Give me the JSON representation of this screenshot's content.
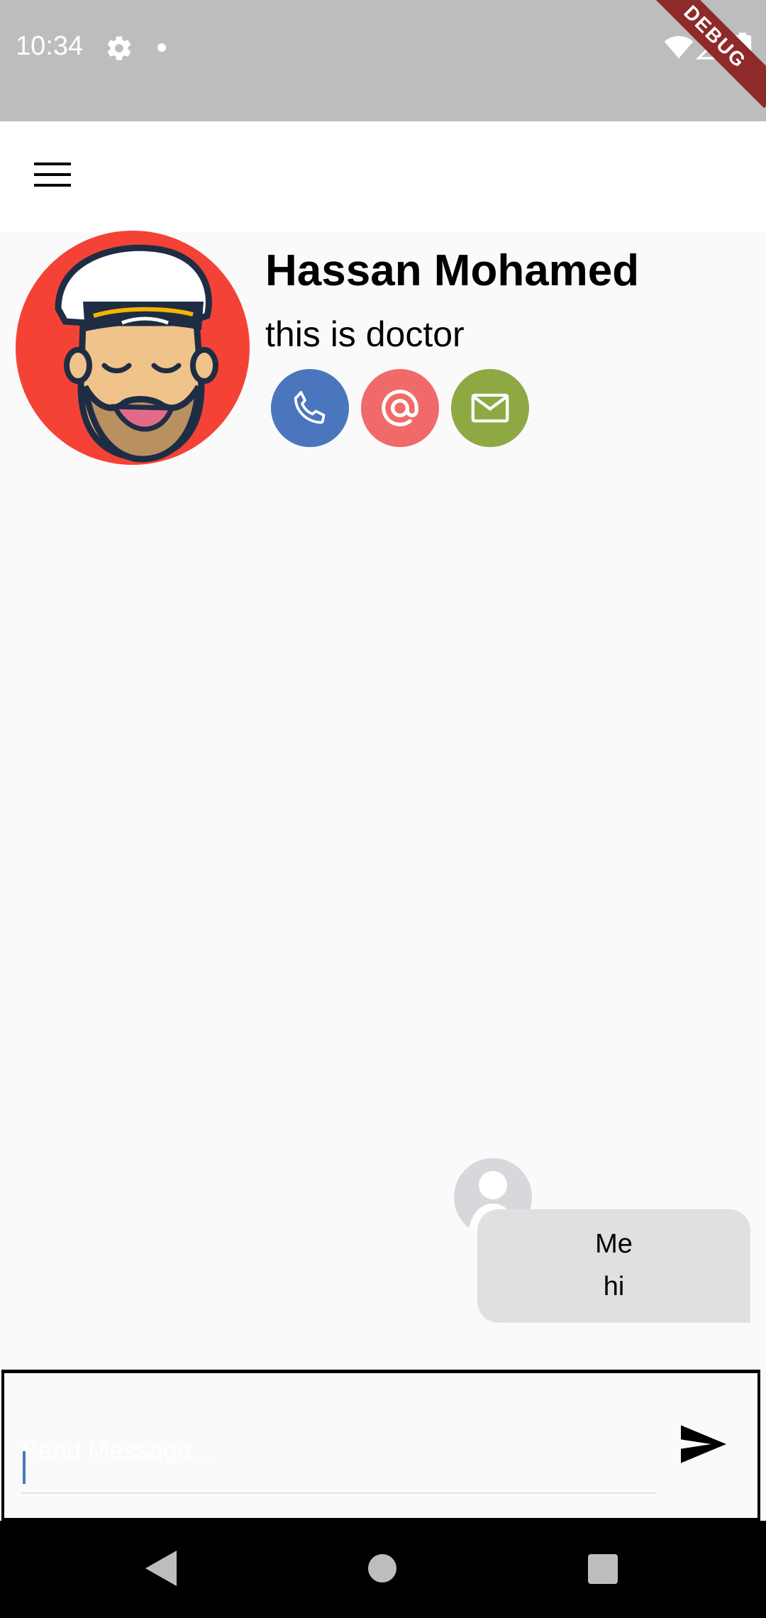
{
  "status_bar": {
    "time": "10:34",
    "icons": [
      "gear-icon",
      "notification-dot-icon",
      "wifi-icon",
      "signal-icon",
      "battery-icon"
    ],
    "debug_label": "DEBUG",
    "background": "#bdbdbd"
  },
  "app_bar": {
    "menu_icon": "hamburger-menu-icon"
  },
  "profile": {
    "name": "Hassan Mohamed",
    "role": "this is doctor",
    "avatar_bg": "#f44336",
    "actions": [
      {
        "icon": "phone-icon",
        "color": "#4a76be"
      },
      {
        "icon": "at-icon",
        "color": "#f16a6a"
      },
      {
        "icon": "mail-icon",
        "color": "#8ea844"
      }
    ]
  },
  "messages": [
    {
      "sender": "Me",
      "text": "hi"
    }
  ],
  "composer": {
    "placeholder": "Send Message...",
    "value": "",
    "send_icon": "send-icon"
  },
  "nav_bar": {
    "icons": [
      "back-icon",
      "home-icon",
      "recents-icon"
    ]
  }
}
